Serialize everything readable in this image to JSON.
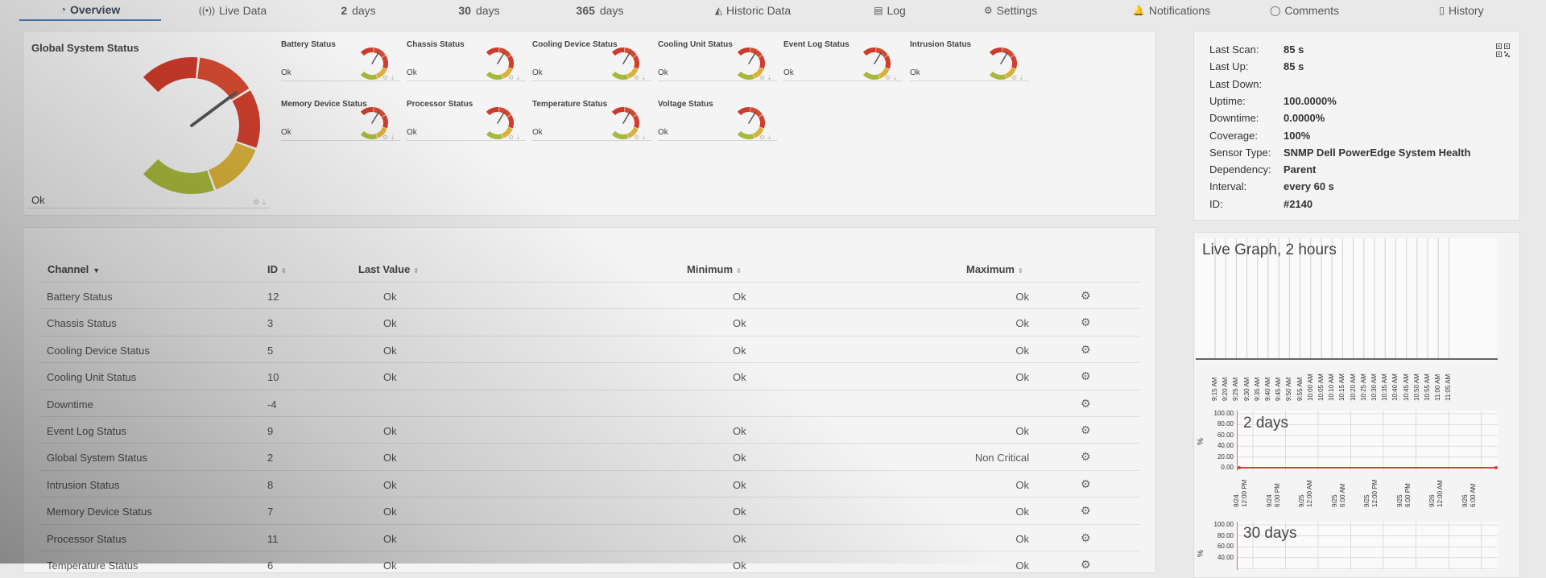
{
  "tabs": [
    {
      "name": "tab-overview",
      "icon": "◔",
      "label": "Overview",
      "active": true
    },
    {
      "name": "tab-live-data",
      "icon": "((•))",
      "label": "Live Data"
    },
    {
      "name": "tab-2-days",
      "num": "2",
      "label": "days"
    },
    {
      "name": "tab-30-days",
      "num": "30",
      "label": "days"
    },
    {
      "name": "tab-365-days",
      "num": "365",
      "label": "days"
    },
    {
      "name": "tab-historic-data",
      "icon": "◭",
      "label": "Historic Data"
    },
    {
      "name": "tab-log",
      "icon": "▤",
      "label": "Log"
    },
    {
      "name": "tab-settings",
      "icon": "⚙",
      "label": "Settings"
    },
    {
      "name": "tab-notifications",
      "icon": "🔔",
      "label": "Notifications"
    },
    {
      "name": "tab-comments",
      "icon": "◯",
      "label": "Comments"
    },
    {
      "name": "tab-history",
      "icon": "▯",
      "label": "History"
    }
  ],
  "global_status": {
    "title": "Global System Status",
    "value": "Ok",
    "gauge_fraction": 0.62
  },
  "gauges": [
    {
      "name": "battery-status",
      "title": "Battery Status",
      "value": "Ok",
      "fraction": 0.55
    },
    {
      "name": "chassis-status",
      "title": "Chassis Status",
      "value": "Ok",
      "fraction": 0.55
    },
    {
      "name": "cooling-device-status",
      "title": "Cooling Device Status",
      "value": "Ok",
      "fraction": 0.55
    },
    {
      "name": "cooling-unit-status",
      "title": "Cooling Unit Status",
      "value": "Ok",
      "fraction": 0.55
    },
    {
      "name": "event-log-status",
      "title": "Event Log Status",
      "value": "Ok",
      "fraction": 0.55
    },
    {
      "name": "intrusion-status",
      "title": "Intrusion Status",
      "value": "Ok",
      "fraction": 0.55
    },
    {
      "name": "memory-device-status",
      "title": "Memory Device Status",
      "value": "Ok",
      "fraction": 0.55
    },
    {
      "name": "processor-status",
      "title": "Processor Status",
      "value": "Ok",
      "fraction": 0.55
    },
    {
      "name": "temperature-status",
      "title": "Temperature Status",
      "value": "Ok",
      "fraction": 0.55
    },
    {
      "name": "voltage-status",
      "title": "Voltage Status",
      "value": "Ok",
      "fraction": 0.55
    }
  ],
  "info": [
    {
      "key": "Last Scan:",
      "value": "85 s"
    },
    {
      "key": "Last Up:",
      "value": "85 s"
    },
    {
      "key": "Last Down:",
      "value": ""
    },
    {
      "key": "Uptime:",
      "value": "100.0000%"
    },
    {
      "key": "Downtime:",
      "value": "0.0000%"
    },
    {
      "key": "Coverage:",
      "value": "100%"
    },
    {
      "key": "Sensor Type:",
      "value": "SNMP Dell PowerEdge System Health"
    },
    {
      "key": "Dependency:",
      "value": "Parent"
    },
    {
      "key": "Interval:",
      "value": "every  60 s"
    },
    {
      "key": "ID:",
      "value": "#2140"
    }
  ],
  "table": {
    "headers": {
      "channel": "Channel",
      "id": "ID",
      "last": "Last Value",
      "min": "Minimum",
      "max": "Maximum"
    },
    "rows": [
      {
        "channel": "Battery Status",
        "id": "12",
        "last": "Ok",
        "min": "Ok",
        "max": "Ok"
      },
      {
        "channel": "Chassis Status",
        "id": "3",
        "last": "Ok",
        "min": "Ok",
        "max": "Ok"
      },
      {
        "channel": "Cooling Device Status",
        "id": "5",
        "last": "Ok",
        "min": "Ok",
        "max": "Ok"
      },
      {
        "channel": "Cooling Unit Status",
        "id": "10",
        "last": "Ok",
        "min": "Ok",
        "max": "Ok"
      },
      {
        "channel": "Downtime",
        "id": "-4",
        "last": "",
        "min": "",
        "max": ""
      },
      {
        "channel": "Event Log Status",
        "id": "9",
        "last": "Ok",
        "min": "Ok",
        "max": "Ok"
      },
      {
        "channel": "Global System Status",
        "id": "2",
        "last": "Ok",
        "min": "Ok",
        "max": "Non Critical"
      },
      {
        "channel": "Intrusion Status",
        "id": "8",
        "last": "Ok",
        "min": "Ok",
        "max": "Ok"
      },
      {
        "channel": "Memory Device Status",
        "id": "7",
        "last": "Ok",
        "min": "Ok",
        "max": "Ok"
      },
      {
        "channel": "Processor Status",
        "id": "11",
        "last": "Ok",
        "min": "Ok",
        "max": "Ok"
      },
      {
        "channel": "Temperature Status",
        "id": "6",
        "last": "Ok",
        "min": "Ok",
        "max": "Ok"
      }
    ]
  },
  "graphs": {
    "live": {
      "title": "Live Graph, 2 hours",
      "ticks": [
        "9:15 AM",
        "9:20 AM",
        "9:25 AM",
        "9:30 AM",
        "9:35 AM",
        "9:40 AM",
        "9:45 AM",
        "9:50 AM",
        "9:55 AM",
        "10:00 AM",
        "10:05 AM",
        "10:10 AM",
        "10:15 AM",
        "10:20 AM",
        "10:25 AM",
        "10:30 AM",
        "10:35 AM",
        "10:40 AM",
        "10:45 AM",
        "10:50 AM",
        "10:55 AM",
        "11:00 AM",
        "11:05 AM"
      ]
    },
    "two_days": {
      "title": "2 days",
      "ylabel": "%",
      "yticks": [
        "100.00",
        "80.00",
        "60.00",
        "40.00",
        "20.00",
        "0.00"
      ],
      "xticks": [
        [
          "9/24",
          "12:00 PM"
        ],
        [
          "9/24",
          "6:00 PM"
        ],
        [
          "9/25",
          "12:00 AM"
        ],
        [
          "9/25",
          "6:00 AM"
        ],
        [
          "9/25",
          "12:00 PM"
        ],
        [
          "9/25",
          "6:00 PM"
        ],
        [
          "9/26",
          "12:00 AM"
        ],
        [
          "9/26",
          "6:00 AM"
        ]
      ],
      "series_values": [
        0,
        0,
        0,
        0,
        0,
        0,
        0,
        0,
        0,
        0,
        0,
        0,
        0,
        0,
        0,
        0,
        0,
        0,
        0,
        0,
        0,
        0,
        0,
        0,
        0,
        0,
        0,
        0,
        0,
        0,
        0,
        0,
        0,
        0,
        0,
        0,
        0,
        0,
        0,
        0,
        0,
        0,
        0,
        0,
        0,
        0
      ],
      "line_color": "#d9402f"
    },
    "thirty_days": {
      "title": "30 days",
      "ylabel": "%",
      "yticks": [
        "100.00",
        "80.00",
        "60.00",
        "40.00"
      ]
    }
  }
}
